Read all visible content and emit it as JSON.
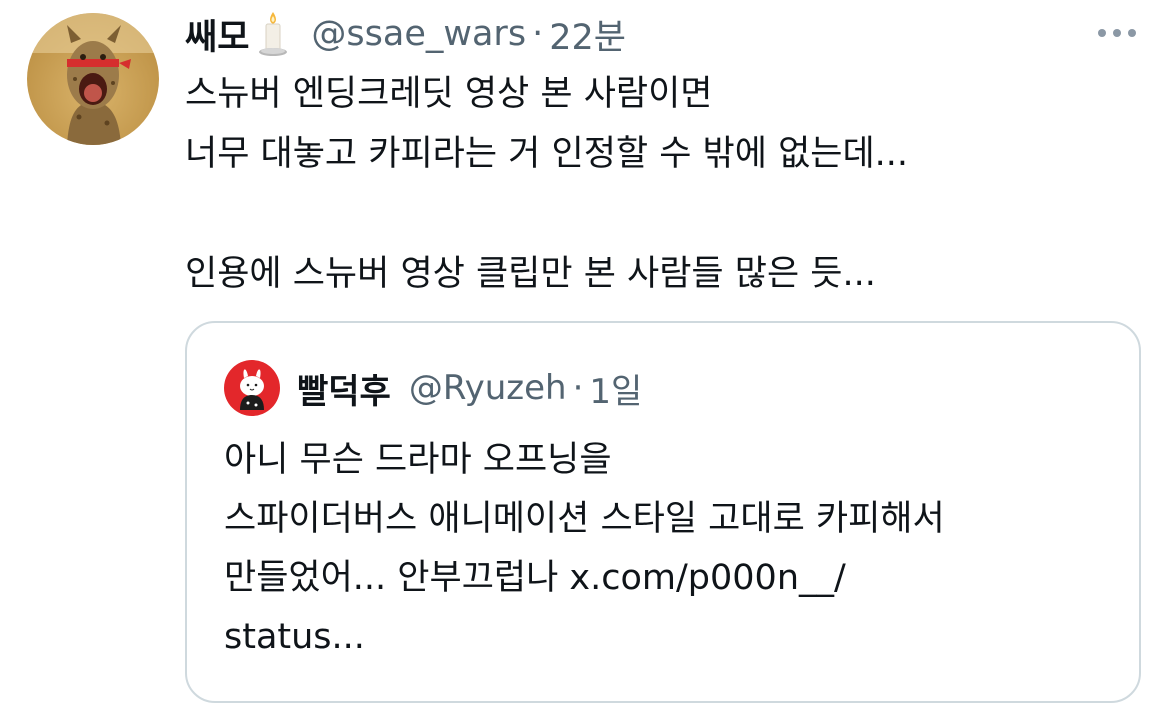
{
  "tweet": {
    "display_name": "쌔모",
    "name_emoji_icon": "candle-icon",
    "handle": "@ssae_wars",
    "separator": "·",
    "time": "22분",
    "text_lines": [
      "스뉴버 엔딩크레딧 영상 본 사람이면",
      "너무 대놓고 카피라는 거 인정할 수 밖에 없는데...",
      "",
      "인용에 스뉴버 영상 클립만 본 사람들 많은 듯..."
    ],
    "more_icon": "more-horizontal-icon"
  },
  "quote": {
    "display_name": "빨덕후",
    "handle": "@Ryuzeh",
    "separator": "·",
    "time": "1일",
    "text_lines": [
      "아니 무슨 드라마 오프닝을",
      "스파이더버스 애니메이션 스타일 고대로 카피해서",
      "만들었어... 안부끄럽나 x.com/p000n__/",
      "status..."
    ]
  },
  "colors": {
    "text_primary": "#0f1419",
    "text_secondary": "#536471",
    "border": "#cfd9de",
    "quote_avatar_bg": "#e3272b"
  }
}
